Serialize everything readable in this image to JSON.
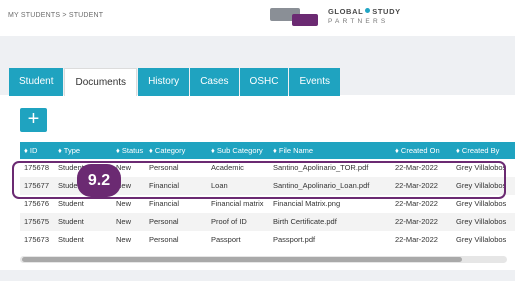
{
  "breadcrumb": "MY STUDENTS > STUDENT",
  "logo": {
    "line1": "GLOBAL",
    "line1b": "STUDY",
    "line2": "PARTNERS"
  },
  "tabs": [
    {
      "label": "Student",
      "active": false
    },
    {
      "label": "Documents",
      "active": true
    },
    {
      "label": "History",
      "active": false
    },
    {
      "label": "Cases",
      "active": false
    },
    {
      "label": "OSHC",
      "active": false
    },
    {
      "label": "Events",
      "active": false
    }
  ],
  "add_button": {
    "label": "+"
  },
  "table": {
    "columns": [
      "♦ ID",
      "♦ Type",
      "♦ Status",
      "♦ Category",
      "♦ Sub Category",
      "♦ File Name",
      "♦ Created On",
      "♦ Created By"
    ],
    "rows": [
      [
        "175678",
        "Student",
        "New",
        "Personal",
        "Academic",
        "Santino_Apolinario_TOR.pdf",
        "22-Mar-2022",
        "Grey Villalobos"
      ],
      [
        "175677",
        "Student",
        "New",
        "Financial",
        "Loan",
        "Santino_Apolinario_Loan.pdf",
        "22-Mar-2022",
        "Grey Villalobos"
      ],
      [
        "175676",
        "Student",
        "New",
        "Financial",
        "Financial matrix",
        "Financial Matrix.png",
        "22-Mar-2022",
        "Grey Villalobos"
      ],
      [
        "175675",
        "Student",
        "New",
        "Personal",
        "Proof of ID",
        "Birth Certificate.pdf",
        "22-Mar-2022",
        "Grey Villalobos"
      ],
      [
        "175673",
        "Student",
        "New",
        "Personal",
        "Passport",
        "Passport.pdf",
        "22-Mar-2022",
        "Grey Villalobos"
      ]
    ]
  },
  "annotation_badge": "9.2",
  "colors": {
    "accent": "#1fa3c0",
    "brand_purple": "#6b2a72"
  }
}
